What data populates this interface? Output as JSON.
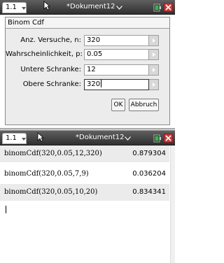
{
  "top_window": {
    "tab_label": "1.1",
    "document_title": "*Dokument12"
  },
  "dialog": {
    "title": "Binom Cdf",
    "fields": [
      {
        "label": "Anz. Versuche, n:",
        "value": "320"
      },
      {
        "label": "Wahrscheinlichkeit, p:",
        "value": "0.05"
      },
      {
        "label": "Untere Schranke:",
        "value": "12"
      },
      {
        "label": "Obere Schranke:",
        "value": "320"
      }
    ],
    "ok_label": "OK",
    "cancel_label": "Abbruch"
  },
  "bottom_window": {
    "tab_label": "1.1",
    "document_title": "*Dokument12"
  },
  "calculator": {
    "entries": [
      {
        "expression": "binomCdf(320,0.05,12,320)",
        "result": "0.879304"
      },
      {
        "expression": "binomCdf(320,0.05,7,9)",
        "result": "0.036204"
      },
      {
        "expression": "binomCdf(320,0.05,10,20)",
        "result": "0.834341"
      }
    ]
  },
  "colors": {
    "titlebar": "#3f3f3f",
    "close_button": "#c83a3a",
    "shaded_row": "#ebebeb"
  },
  "icons": [
    "chevron-down-icon",
    "battery-icon",
    "close-icon",
    "mouse-pointer-icon",
    "dropdown-arrow-icon"
  ]
}
